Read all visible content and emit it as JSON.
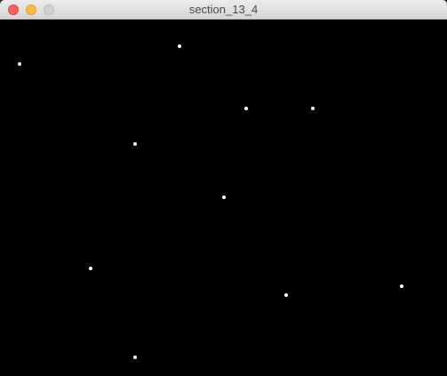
{
  "window": {
    "title": "section_13_4",
    "controls": [
      "close",
      "minimize",
      "zoom"
    ]
  },
  "canvas": {
    "background": "#000000",
    "dot_color": "#ffffff",
    "dot_count": 11
  }
}
